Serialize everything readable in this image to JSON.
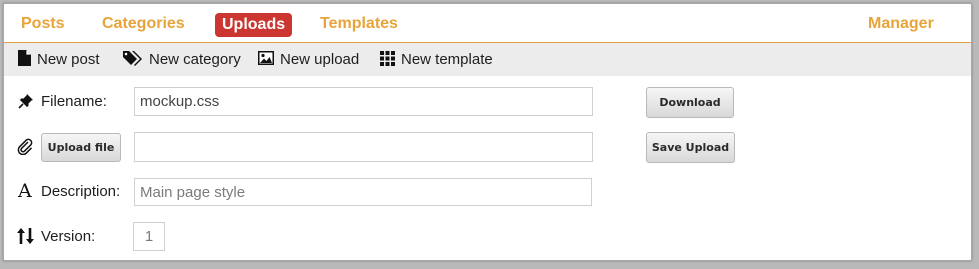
{
  "nav": {
    "posts": "Posts",
    "categories": "Categories",
    "uploads": "Uploads",
    "templates": "Templates",
    "manager": "Manager"
  },
  "toolbar": {
    "new_post": "New post",
    "new_category": "New category",
    "new_upload": "New upload",
    "new_template": "New template"
  },
  "form": {
    "filename_label": "Filename:",
    "filename_value": "mockup.css",
    "upload_file_button": "Upload file",
    "file_value": "",
    "description_label": "Description:",
    "description_placeholder": "Main page style",
    "version_label": "Version:",
    "version_placeholder": "1"
  },
  "actions": {
    "download": "Download",
    "save_upload": "Save Upload"
  },
  "colors": {
    "accent": "#e8a33a",
    "active_tab": "#cc3631",
    "toolbar_bg": "#ececec"
  }
}
